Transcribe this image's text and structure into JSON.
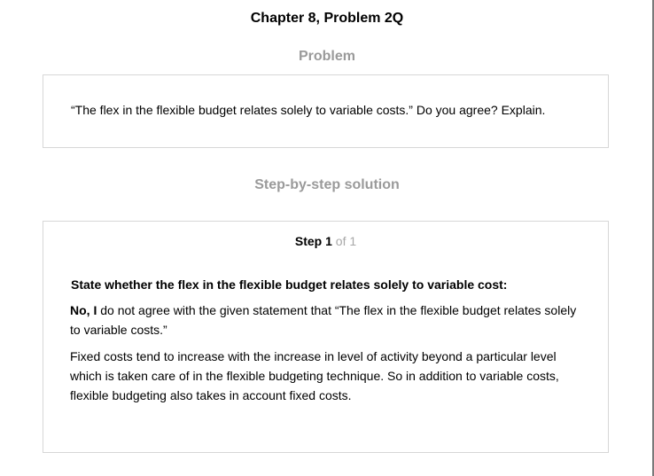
{
  "header": {
    "chapter_title": "Chapter 8, Problem 2Q"
  },
  "problem": {
    "heading": "Problem",
    "text": "“The flex in the flexible budget relates solely to variable costs.” Do you agree? Explain."
  },
  "solution": {
    "heading": "Step-by-step solution",
    "step": {
      "word": "Step",
      "number": "1",
      "of_text": "of 1"
    },
    "subheading": "State whether the flex in the flexible budget relates solely to variable cost:",
    "para1_bold": "No, I",
    "para1_rest": " do not agree with the given statement that “The flex in the flexible budget relates solely to variable costs.”",
    "para2": "Fixed costs tend to increase with the increase in level of activity beyond a particular level which is taken care of in the flexible budgeting technique. So in addition to variable costs, flexible budgeting also takes in account fixed costs."
  }
}
